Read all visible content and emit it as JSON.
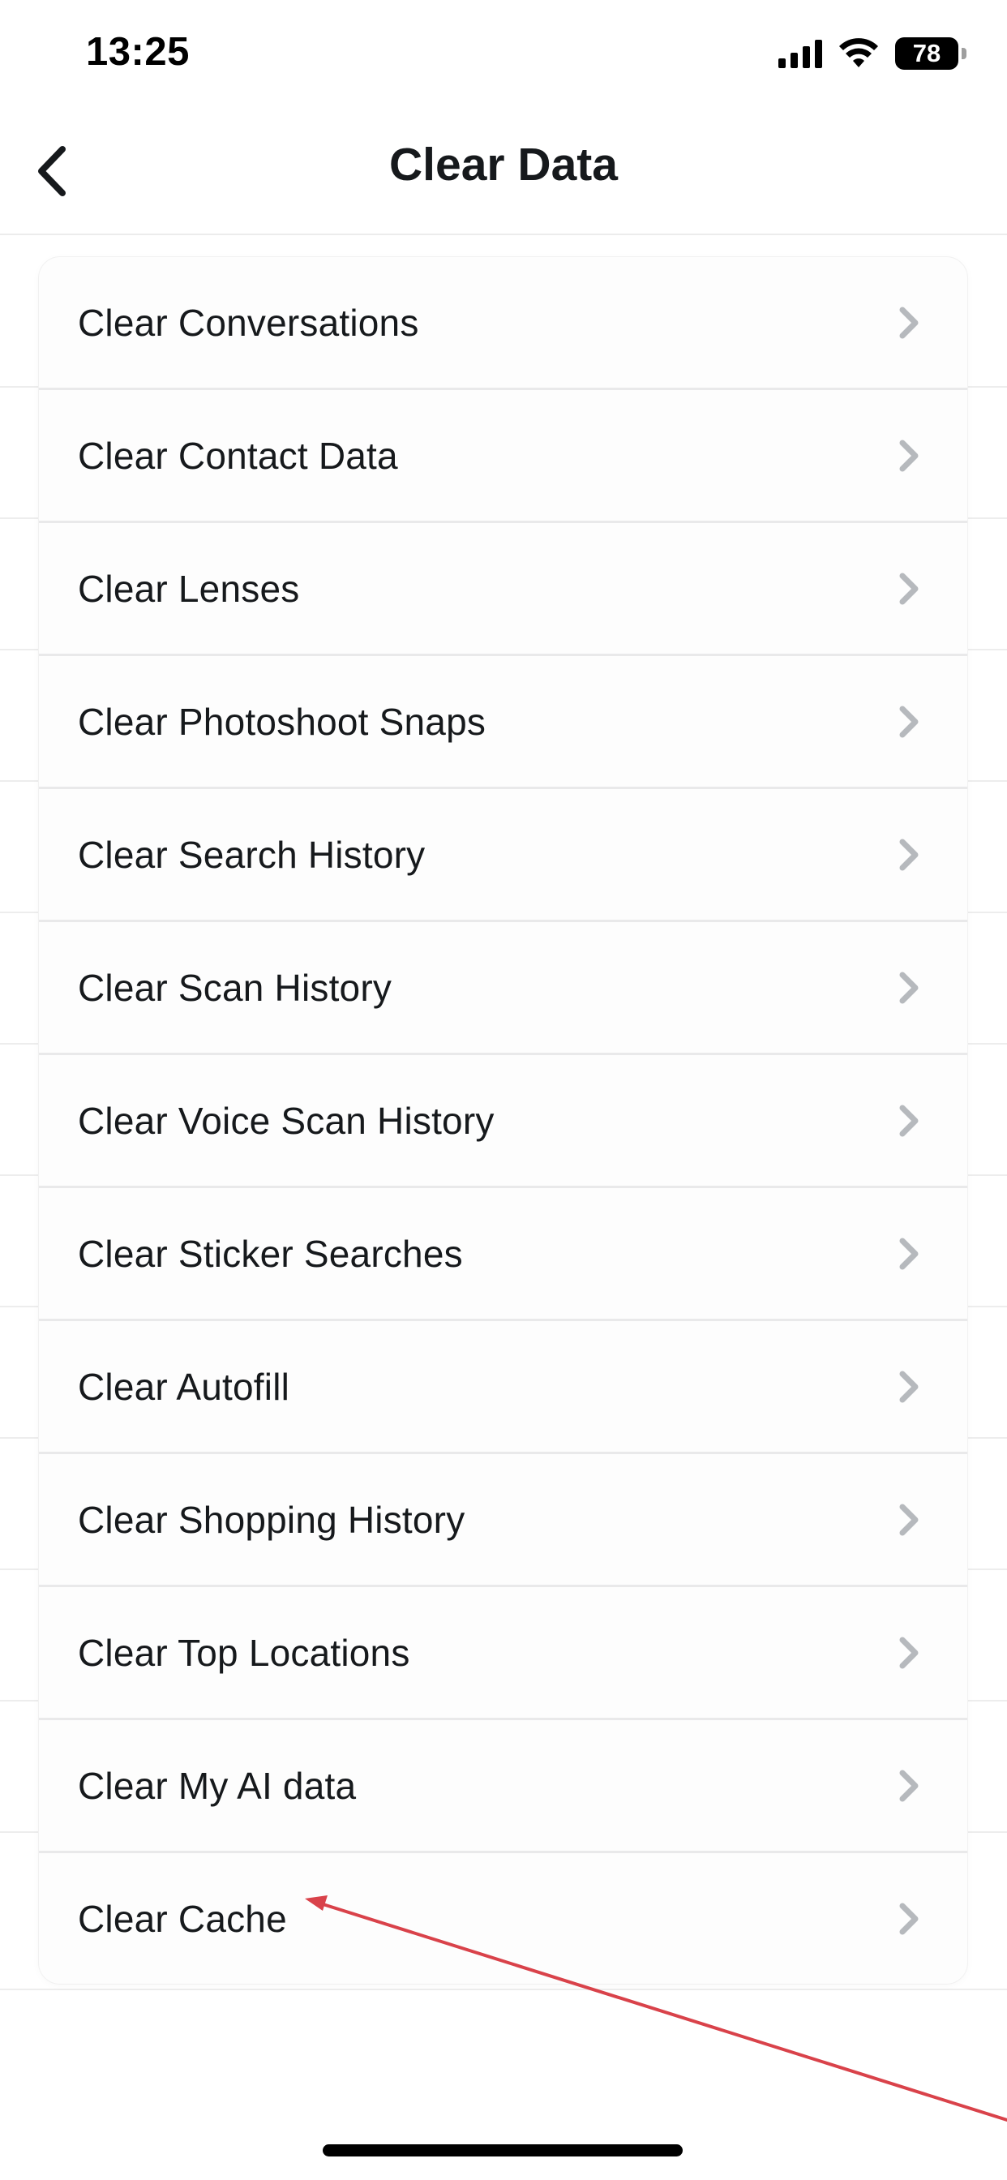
{
  "status_bar": {
    "time": "13:25",
    "battery": "78",
    "icons": [
      "signal-icon",
      "wifi-icon",
      "battery-icon"
    ]
  },
  "nav": {
    "back_icon": "chevron-left-icon",
    "title": "Clear Data"
  },
  "items": [
    {
      "label": "Clear Conversations"
    },
    {
      "label": "Clear Contact Data"
    },
    {
      "label": "Clear Lenses"
    },
    {
      "label": "Clear Photoshoot Snaps"
    },
    {
      "label": "Clear Search History"
    },
    {
      "label": "Clear Scan History"
    },
    {
      "label": "Clear Voice Scan History"
    },
    {
      "label": "Clear Sticker Searches"
    },
    {
      "label": "Clear Autofill"
    },
    {
      "label": "Clear Shopping History"
    },
    {
      "label": "Clear Top Locations"
    },
    {
      "label": "Clear My AI data"
    },
    {
      "label": "Clear Cache"
    }
  ],
  "colors": {
    "chevron": "#b6b9bd",
    "annotation_arrow": "#d9424a",
    "separator": "#e9e9ea"
  }
}
